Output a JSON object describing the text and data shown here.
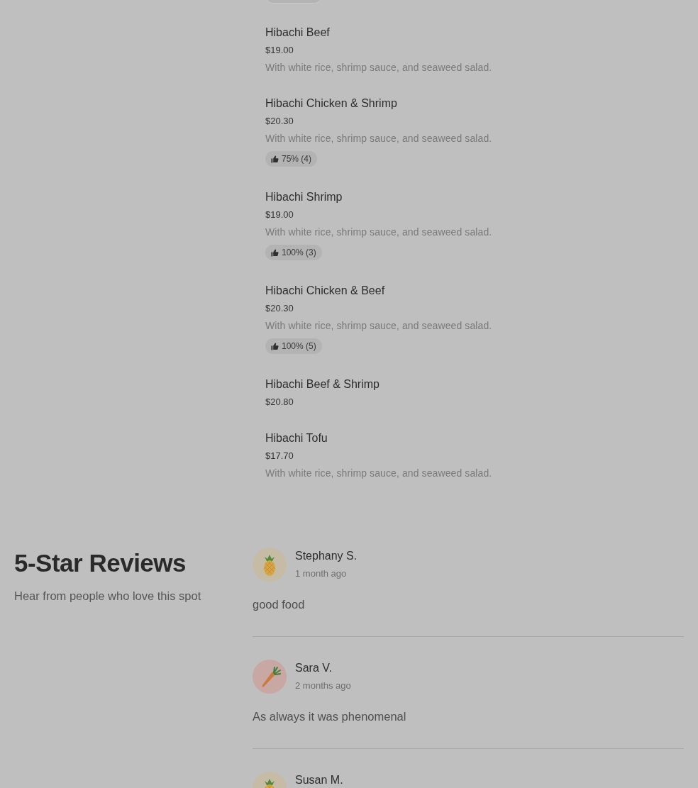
{
  "menu": {
    "clipped_badge_above": true,
    "items": [
      {
        "name": "Hibachi Beef",
        "price": "$19.00",
        "description": "With white rice, shrimp sauce, and seaweed salad."
      },
      {
        "name": "Hibachi Chicken & Shrimp",
        "price": "$20.30",
        "description": "With white rice, shrimp sauce, and seaweed salad.",
        "rating": "75% (4)"
      },
      {
        "name": "Hibachi Shrimp",
        "price": "$19.00",
        "description": "With white rice, shrimp sauce, and seaweed salad.",
        "rating": "100% (3)"
      },
      {
        "name": "Hibachi Chicken & Beef",
        "price": "$20.30",
        "description": "With white rice, shrimp sauce, and seaweed salad.",
        "rating": "100% (5)"
      },
      {
        "name": "Hibachi Beef & Shrimp",
        "price": "$20.80"
      },
      {
        "name": "Hibachi Tofu",
        "price": "$17.70",
        "description": "With white rice, shrimp sauce, and seaweed salad."
      }
    ]
  },
  "reviews": {
    "title": "5-Star Reviews",
    "subtitle": "Hear from people who love this spot",
    "items": [
      {
        "kind": "pineapple",
        "name": "Stephany S.",
        "time": "1 month ago",
        "text": "good food"
      },
      {
        "kind": "carrot",
        "name": "Sara V.",
        "time": "2 months ago",
        "text": "As always it was phenomenal"
      },
      {
        "kind": "pineapple",
        "name": "Susan M."
      }
    ]
  }
}
